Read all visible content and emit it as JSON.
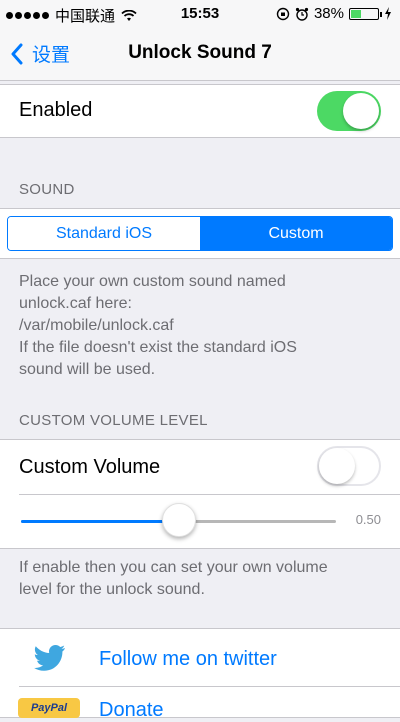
{
  "statusbar": {
    "carrier": "中国联通",
    "time": "15:53",
    "battery": "38%",
    "battery_level": 0.38,
    "signal_bars": 5
  },
  "navbar": {
    "back_label": "设置",
    "title": "Unlock Sound 7"
  },
  "enabled_cell": {
    "label": "Enabled",
    "toggle_on": true
  },
  "sound_section": {
    "header": "SOUND",
    "segments": [
      "Standard iOS",
      "Custom"
    ],
    "selected_segment": "Custom",
    "footer_lines": [
      "Place your own custom sound named",
      "unlock.caf here:",
      "/var/mobile/unlock.caf",
      "If the file doesn't exist the standard iOS",
      "sound will be used."
    ]
  },
  "volume_section": {
    "header": "CUSTOM VOLUME LEVEL",
    "label": "Custom Volume",
    "toggle_on": false,
    "slider_value": 0.5,
    "slider_display": "0.50",
    "footer_lines": [
      "If enable then you can set your own volume",
      "level for the unlock sound."
    ]
  },
  "links": {
    "twitter_label": "Follow me on twitter",
    "donate_label": "Donate",
    "paypal_text": "PayPal"
  },
  "colors": {
    "accent": "#007aff",
    "toggle_on": "#4cd964",
    "background": "#efeff4"
  }
}
